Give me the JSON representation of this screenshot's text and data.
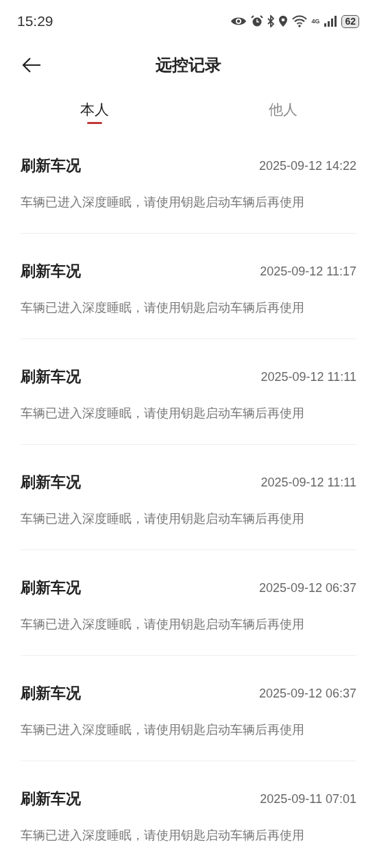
{
  "status_bar": {
    "time": "15:29",
    "network": "4G",
    "battery": "62"
  },
  "header": {
    "title": "远控记录"
  },
  "tabs": [
    {
      "label": "本人",
      "selected": true
    },
    {
      "label": "他人",
      "selected": false
    }
  ],
  "records": [
    {
      "title": "刷新车况",
      "time": "2025-09-12 14:22",
      "message": "车辆已进入深度睡眠，请使用钥匙启动车辆后再使用"
    },
    {
      "title": "刷新车况",
      "time": "2025-09-12 11:17",
      "message": "车辆已进入深度睡眠，请使用钥匙启动车辆后再使用"
    },
    {
      "title": "刷新车况",
      "time": "2025-09-12 11:11",
      "message": "车辆已进入深度睡眠，请使用钥匙启动车辆后再使用"
    },
    {
      "title": "刷新车况",
      "time": "2025-09-12 11:11",
      "message": "车辆已进入深度睡眠，请使用钥匙启动车辆后再使用"
    },
    {
      "title": "刷新车况",
      "time": "2025-09-12 06:37",
      "message": "车辆已进入深度睡眠，请使用钥匙启动车辆后再使用"
    },
    {
      "title": "刷新车况",
      "time": "2025-09-12 06:37",
      "message": "车辆已进入深度睡眠，请使用钥匙启动车辆后再使用"
    },
    {
      "title": "刷新车况",
      "time": "2025-09-11 07:01",
      "message": "车辆已进入深度睡眠，请使用钥匙启动车辆后再使用"
    }
  ]
}
